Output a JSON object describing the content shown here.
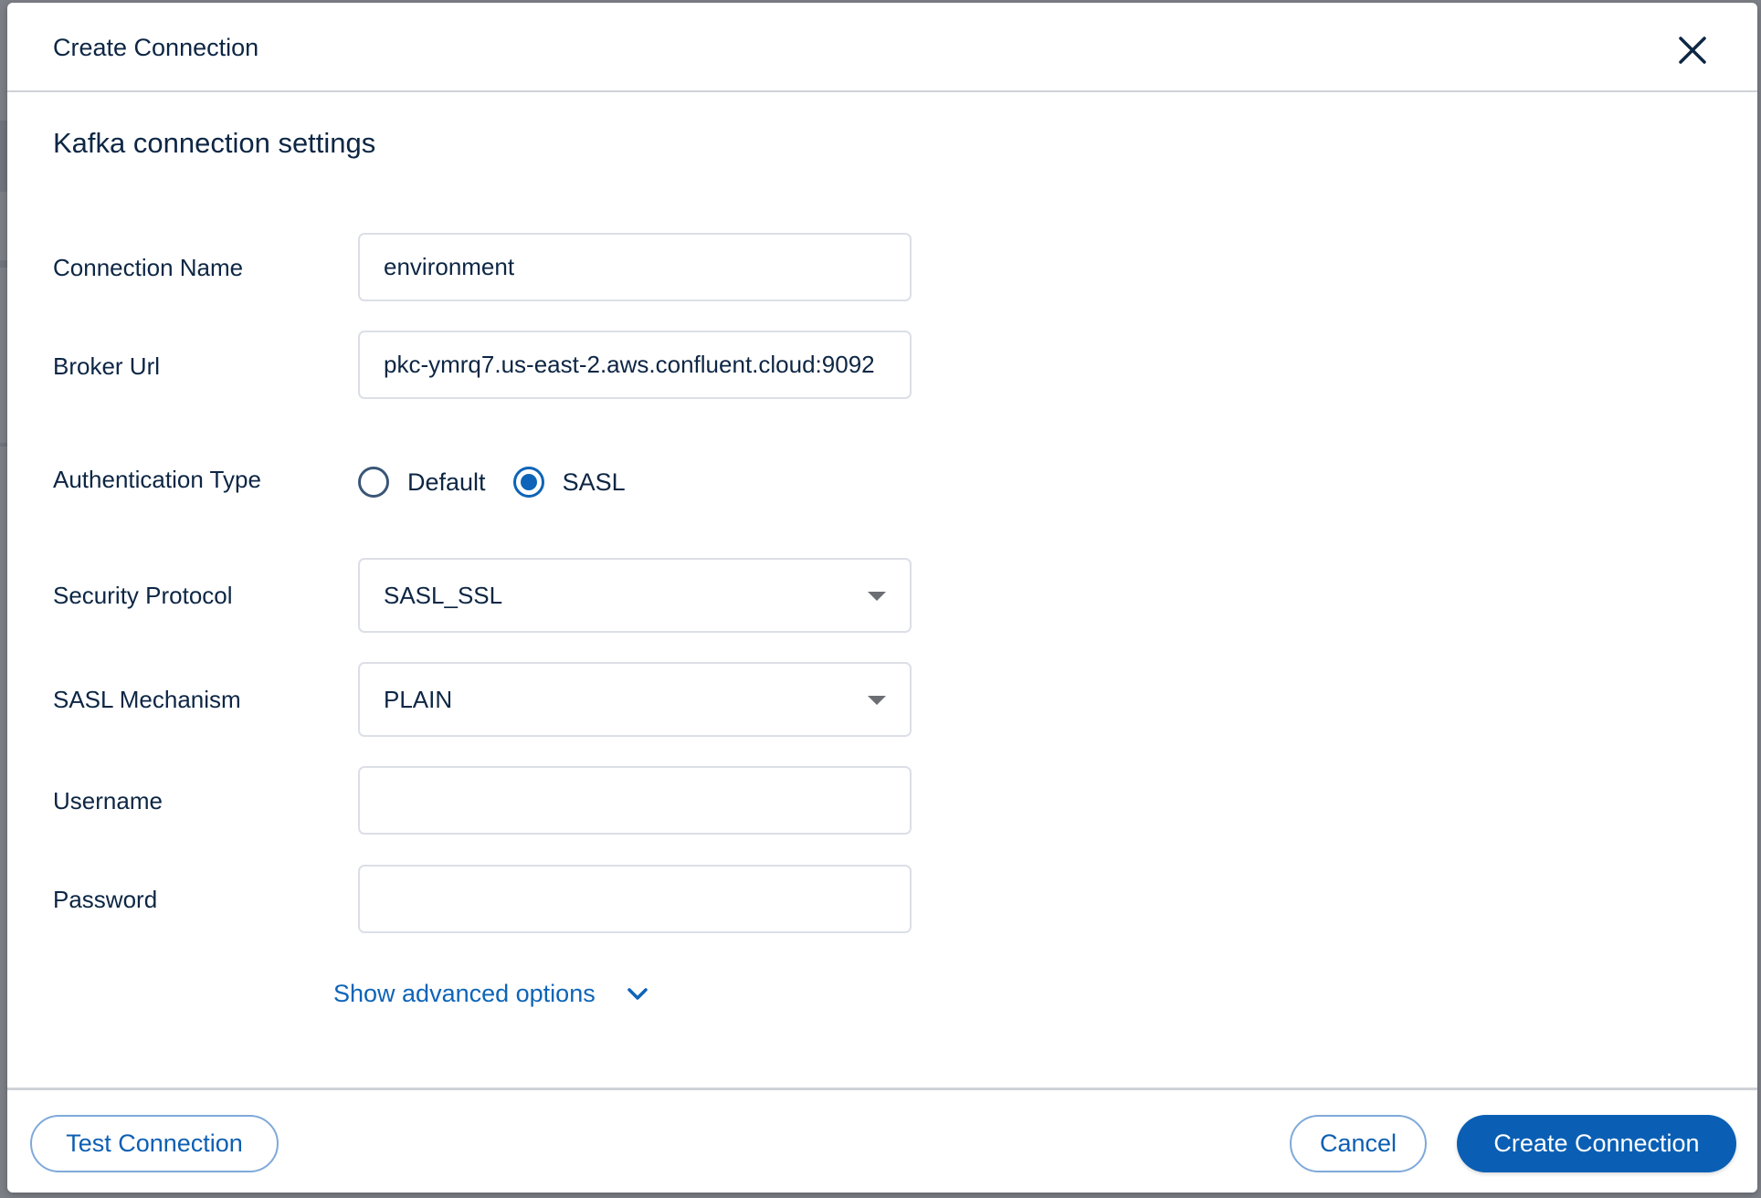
{
  "dialog": {
    "title": "Create Connection",
    "close_icon": "close-icon"
  },
  "section": {
    "title": "Kafka connection settings"
  },
  "form": {
    "connection_name": {
      "label": "Connection Name",
      "value": "environment"
    },
    "broker_url": {
      "label": "Broker Url",
      "value": "pkc-ymrq7.us-east-2.aws.confluent.cloud:9092"
    },
    "authentication_type": {
      "label": "Authentication Type",
      "options": [
        {
          "label": "Default",
          "checked": false
        },
        {
          "label": "SASL",
          "checked": true
        }
      ]
    },
    "security_protocol": {
      "label": "Security Protocol",
      "value": "SASL_SSL"
    },
    "sasl_mechanism": {
      "label": "SASL Mechanism",
      "value": "PLAIN"
    },
    "username": {
      "label": "Username",
      "value": ""
    },
    "password": {
      "label": "Password",
      "value": ""
    },
    "advanced_toggle": {
      "label": "Show advanced options",
      "icon": "chevron-down-icon"
    }
  },
  "footer": {
    "test_label": "Test Connection",
    "cancel_label": "Cancel",
    "create_label": "Create Connection"
  },
  "colors": {
    "accent": "#0a5fb4",
    "text": "#0d2644",
    "border": "#dcdfe6",
    "backdrop": "#7c7f86"
  }
}
